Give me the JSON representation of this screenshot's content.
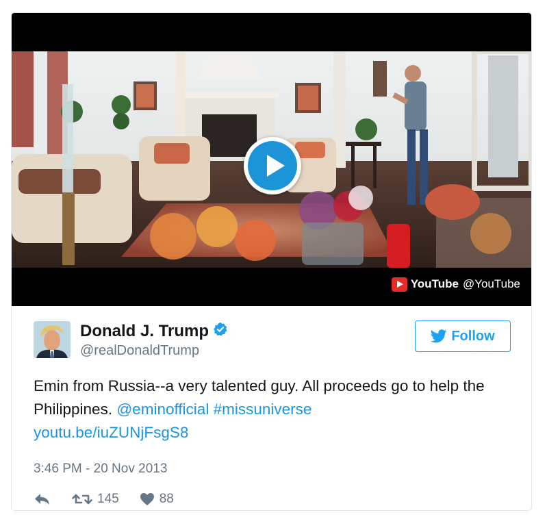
{
  "media": {
    "play_icon": "play-icon",
    "provider_logo": "youtube-logo-icon",
    "provider_name": "YouTube",
    "provider_handle": "@YouTube"
  },
  "author": {
    "name": "Donald J. Trump",
    "screen_name": "@realDonaldTrump",
    "verified_icon": "verified-badge-icon"
  },
  "follow_button": {
    "label": "Follow",
    "icon": "twitter-bird-icon"
  },
  "tweet": {
    "text_plain": "Emin from Russia--a very talented guy. All proceeds go to help the Philippines.",
    "mention": "@eminofficial",
    "hashtag": "#missuniverse",
    "link": "youtu.be/iuZUNjFsgS8",
    "timestamp": "3:46 PM - 20 Nov 2013"
  },
  "actions": {
    "reply_icon": "reply-icon",
    "retweet_icon": "retweet-icon",
    "retweet_count": "145",
    "like_icon": "heart-icon",
    "like_count": "88"
  },
  "colors": {
    "accent": "#1da1f2",
    "link": "#1b95e0",
    "muted": "#657786",
    "border": "#e1e8ed",
    "youtube_red": "#e52d27"
  }
}
